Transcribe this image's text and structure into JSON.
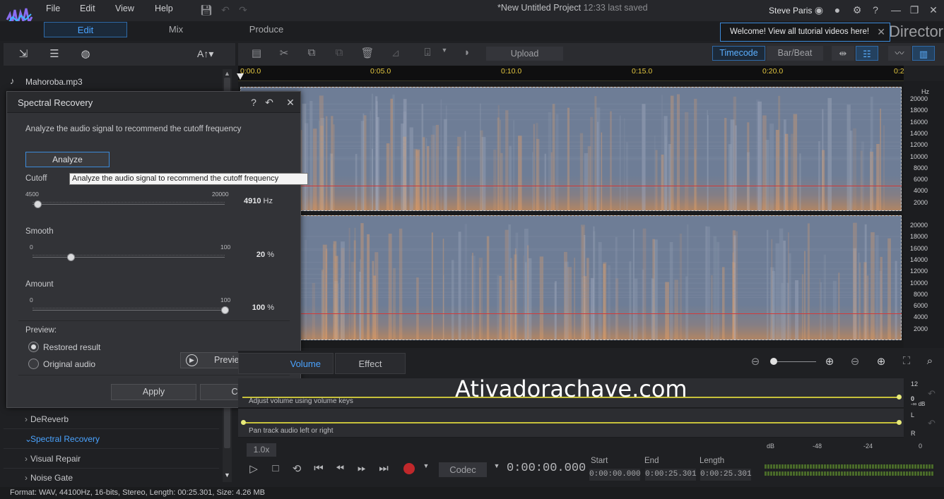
{
  "menu": [
    "File",
    "Edit",
    "View",
    "Help"
  ],
  "project": {
    "title": "*New Untitled Project",
    "saved": "12:33 last saved"
  },
  "user": {
    "name": "Steve Paris"
  },
  "modes": [
    "Edit",
    "Mix",
    "Produce"
  ],
  "welcome": "Welcome! View all tutorial videos here!",
  "brand": "Director",
  "left_panel": {
    "toolbar_text": "A↑▾",
    "file": "Mahoroba.mp3",
    "items": [
      "DeReverb",
      "Spectral Recovery",
      "Visual Repair",
      "Noise Gate"
    ]
  },
  "dialog": {
    "title": "Spectral Recovery",
    "description": "Analyze the audio signal to recommend the cutoff frequency",
    "analyze": "Analyze",
    "tooltip": "Analyze the audio signal to recommend the cutoff frequency",
    "cutoff": {
      "label": "Cutoff",
      "min": "4500",
      "max": "20000",
      "value": "4910",
      "unit": "Hz",
      "level": 0.0265
    },
    "smooth": {
      "label": "Smooth",
      "min": "0",
      "max": "100",
      "value": "20",
      "unit": "%",
      "level": 0.2
    },
    "amount": {
      "label": "Amount",
      "min": "0",
      "max": "100",
      "value": "100",
      "unit": "%",
      "level": 1.0
    },
    "preview_label": "Preview:",
    "option_restored": "Restored result",
    "option_original": "Original audio",
    "preview_button": "Preview",
    "apply": "Apply",
    "close": "Close"
  },
  "toolbar": {
    "upload": "Upload",
    "timecode": "Timecode",
    "barbeat": "Bar/Beat"
  },
  "ruler": [
    "0:00.0",
    "0:05.0",
    "0:10.0",
    "0:15.0",
    "0:20.0",
    "0:2"
  ],
  "hz_axis": {
    "unit": "Hz",
    "ticks": [
      "20000",
      "18000",
      "16000",
      "14000",
      "12000",
      "10000",
      "8000",
      "6000",
      "4000",
      "2000"
    ]
  },
  "lower_tabs": {
    "volume": "Volume",
    "effect": "Effect"
  },
  "tracks": {
    "volume_hint": "Adjust volume using volume keys",
    "pan_hint": "Pan track audio left or right",
    "scale_top": "12",
    "scale_zero": "0",
    "scale_db": "-∞ dB",
    "scale_l": "L",
    "scale_r": "R"
  },
  "watermark": "Ativadorachave.com",
  "transport": {
    "speed": "1.0x",
    "codec": "Codec",
    "timecode": "0:00:00.000",
    "start_label": "Start",
    "end_label": "End",
    "length_label": "Length",
    "start": "0:00:00.000",
    "end": "0:00:25.301",
    "length": "0:00:25.301"
  },
  "meter_scale": [
    "dB",
    "-48",
    "-24",
    "0"
  ],
  "status": "Format: WAV, 44100Hz, 16-bits, Stereo, Length: 00:25.301, Size: 4.26 MB"
}
